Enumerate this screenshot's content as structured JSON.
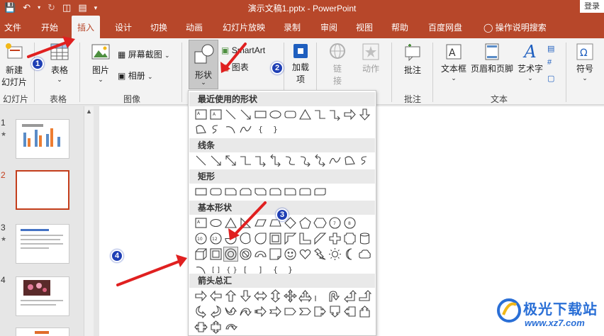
{
  "titlebar": {
    "qat_icons": [
      "save-icon",
      "undo-icon",
      "redo-icon",
      "present-from-start-icon",
      "print-preview-icon",
      "customize-qat-icon"
    ],
    "title": "演示文稿1.pptx  -  PowerPoint",
    "login": "登录",
    "color": "#b7472a"
  },
  "tabs": [
    "文件",
    "开始",
    "插入",
    "设计",
    "切换",
    "动画",
    "幻灯片放映",
    "录制",
    "审阅",
    "视图",
    "帮助",
    "百度网盘",
    "操作说明搜索"
  ],
  "active_tab": "插入",
  "ribbon": {
    "new_slide": {
      "line1": "新建",
      "line2": "幻灯片"
    },
    "table": "表格",
    "picture": "图片",
    "screenshot": "屏幕截图",
    "album": "相册",
    "shapes": "形状",
    "smartart": "SmartArt",
    "chart": "图表",
    "addins": {
      "line1": "加载",
      "line2": "项"
    },
    "link": {
      "line1": "链",
      "line2": "接"
    },
    "action": "动作",
    "comment": "批注",
    "textbox": "文本框",
    "header_footer": "页眉和页脚",
    "wordart": "艺术字",
    "symbol": "符号",
    "groups": {
      "slides": "幻灯片",
      "tables": "表格",
      "images": "图像",
      "comments": "批注",
      "text": "文本"
    }
  },
  "slide_panel": {
    "slides": [
      {
        "num": "1",
        "star": "★"
      },
      {
        "num": "2",
        "star": ""
      },
      {
        "num": "3",
        "star": "★"
      },
      {
        "num": "4",
        "star": ""
      }
    ]
  },
  "shapes_menu": {
    "sections": [
      "最近使用的形状",
      "线条",
      "矩形",
      "基本形状",
      "箭头总汇"
    ]
  },
  "callouts": [
    "1",
    "2",
    "3",
    "4"
  ],
  "watermark": {
    "brand": "极光下载站",
    "url": "www.xz7.com"
  }
}
